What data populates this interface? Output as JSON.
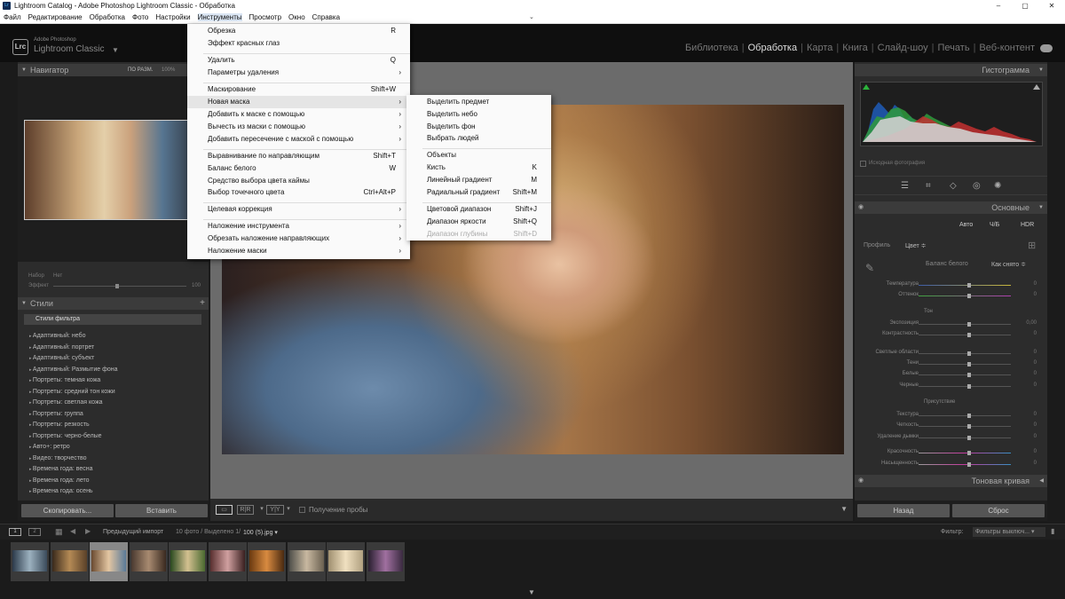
{
  "window": {
    "title": "Lightroom Catalog - Adobe Photoshop Lightroom Classic - Обработка",
    "icon": "Lr",
    "minimize": "–",
    "maximize": "▢",
    "close": "✕"
  },
  "menubar": [
    "Файл",
    "Редактирование",
    "Обработка",
    "Фото",
    "Настройки",
    "Инструменты",
    "Просмотр",
    "Окно",
    "Справка"
  ],
  "identity": {
    "small": "Adobe Photoshop",
    "large": "Lightroom Classic",
    "logo": "Lrc"
  },
  "modules": [
    "Библиотека",
    "Обработка",
    "Карта",
    "Книга",
    "Слайд-шоу",
    "Печать",
    "Веб-контент"
  ],
  "left": {
    "navigator_title": "Навигатор",
    "nav_fit": "ПО РАЗМ.",
    "nav_100": "100%",
    "preset_label": "Набор",
    "preset_value": "Нет",
    "effect_label": "Эффект",
    "effect_value": "100",
    "styles_title": "Стили",
    "filter_item": "Стили фильтра",
    "styles": [
      "Адаптивный: небо",
      "Адаптивный: портрет",
      "Адаптивный: субъект",
      "Адаптивный: Размытие фона",
      "Портреты: темная кожа",
      "Портреты: средний тон кожи",
      "Портреты: светлая кожа",
      "Портреты: группа",
      "Портреты: резкость",
      "Портреты: черно-белые",
      "Авто+: ретро",
      "Видео: творчество",
      "Времена года: весна",
      "Времена года: лето",
      "Времена года: осень"
    ],
    "copy_btn": "Скопировать...",
    "paste_btn": "Вставить"
  },
  "center": {
    "probe_label": "Получение пробы"
  },
  "right": {
    "histogram_title": "Гистограмма",
    "original_photo": "Исходная фотография",
    "basic_title": "Основные",
    "mode_auto": "Авто",
    "mode_bw": "Ч/Б",
    "mode_hdr": "HDR",
    "profile_label": "Профиль",
    "profile_value": "Цвет ≑",
    "wb_label": "Баланс белого",
    "wb_value": "Как снято ≑",
    "temp": "Температура",
    "tint": "Оттенок",
    "tone_head": "Тон",
    "exposure": "Экспозиция",
    "exposure_val": "0,00",
    "contrast": "Контрастность",
    "highlights": "Светлые области",
    "shadows": "Тени",
    "whites": "Белые",
    "blacks": "Черные",
    "presence_head": "Присутствие",
    "texture": "Текстура",
    "clarity": "Четкость",
    "dehaze": "Удаление дымки",
    "vibrance": "Красочность",
    "saturation": "Насыщенность",
    "zero": "0",
    "tone_curve": "Тоновая кривая",
    "back_btn": "Назад",
    "reset_btn": "Сброс"
  },
  "filmstrip": {
    "previous_import": "Предыдущий импорт",
    "count": "10 фото / Выделено 1/",
    "file": "100 (5).jpg ▾",
    "filter_label": "Фильтр:",
    "filter_value": "Фильтры выключ... ▾",
    "view1": "1",
    "view2": "2"
  },
  "menu": {
    "items": [
      {
        "label": "Обрезка",
        "shortcut": "R"
      },
      {
        "label": "Эффект красных глаз",
        "shortcut": ""
      },
      {
        "label": "Удалить",
        "shortcut": "Q"
      },
      {
        "label": "Параметры удаления",
        "shortcut": "›"
      },
      {
        "label": "Маскирование",
        "shortcut": "Shift+W"
      },
      {
        "label": "Новая маска",
        "shortcut": "›"
      },
      {
        "label": "Добавить к маске с помощью",
        "shortcut": "›"
      },
      {
        "label": "Вычесть из маски с помощью",
        "shortcut": "›"
      },
      {
        "label": "Добавить пересечение с маской с помощью",
        "shortcut": "›"
      },
      {
        "label": "Выравнивание по направляющим",
        "shortcut": "Shift+T"
      },
      {
        "label": "Баланс белого",
        "shortcut": "W"
      },
      {
        "label": "Средство выбора цвета каймы",
        "shortcut": ""
      },
      {
        "label": "Выбор точечного цвета",
        "shortcut": "Ctrl+Alt+P"
      },
      {
        "label": "Целевая коррекция",
        "shortcut": "›"
      },
      {
        "label": "Наложение инструмента",
        "shortcut": "›"
      },
      {
        "label": "Обрезать наложение направляющих",
        "shortcut": "›"
      },
      {
        "label": "Наложение маски",
        "shortcut": "›"
      }
    ]
  },
  "submenu": {
    "items": [
      {
        "label": "Выделить предмет",
        "shortcut": ""
      },
      {
        "label": "Выделить небо",
        "shortcut": ""
      },
      {
        "label": "Выделить фон",
        "shortcut": ""
      },
      {
        "label": "Выбрать людей",
        "shortcut": ""
      },
      {
        "label": "Объекты",
        "shortcut": ""
      },
      {
        "label": "Кисть",
        "shortcut": "K"
      },
      {
        "label": "Линейный градиент",
        "shortcut": "M"
      },
      {
        "label": "Радиальный градиент",
        "shortcut": "Shift+M"
      },
      {
        "label": "Цветовой диапазон",
        "shortcut": "Shift+J"
      },
      {
        "label": "Диапазон яркости",
        "shortcut": "Shift+Q"
      },
      {
        "label": "Диапазон глубины",
        "shortcut": "Shift+D"
      }
    ]
  }
}
